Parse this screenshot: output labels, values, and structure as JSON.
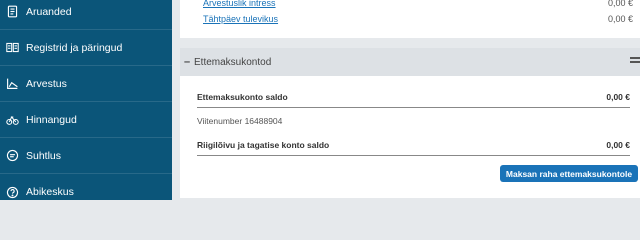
{
  "sidebar": {
    "items": [
      {
        "label": "Aruanded",
        "icon": "document-icon"
      },
      {
        "label": "Registrid ja päringud",
        "icon": "registry-icon"
      },
      {
        "label": "Arvestus",
        "icon": "chart-icon"
      },
      {
        "label": "Hinnangud",
        "icon": "bicycle-icon"
      },
      {
        "label": "Suhtlus",
        "icon": "chat-icon"
      },
      {
        "label": "Abikeskus",
        "icon": "help-icon"
      }
    ]
  },
  "top_rows": [
    {
      "label": "Arvestuslik intress",
      "amount": "0,00 €"
    },
    {
      "label": "Tähtpäev tulevikus",
      "amount": "0,00 €"
    }
  ],
  "section": {
    "title": "Ettemaksukontod",
    "balance_label": "Ettemaksukonto saldo",
    "balance_amount": "0,00 €",
    "reference_text": "Viitenumber 16488904",
    "state_fee_label": "Riigilõivu ja tagatise konto saldo",
    "state_fee_amount": "0,00 €",
    "pay_button_label": "Maksan raha ettemaksukontole"
  },
  "colors": {
    "sidebar": "#0b5579",
    "accent": "#1a73b8",
    "background": "#e6e9ec"
  }
}
